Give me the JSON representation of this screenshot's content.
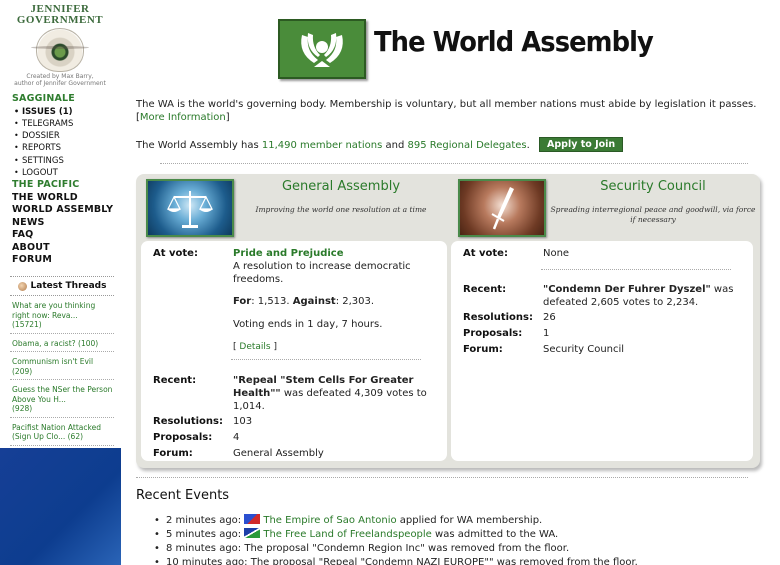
{
  "logo": {
    "line1": "JENNIFER",
    "line2": "GOVERNMENT",
    "credit1": "Created by Max Barry,",
    "credit2": "author of Jennifer Government"
  },
  "nav": {
    "region": "SAGGINALE",
    "issues": "ISSUES (1)",
    "telegrams": "TELEGRAMS",
    "dossier": "DOSSIER",
    "reports": "REPORTS",
    "settings": "SETTINGS",
    "logout": "LOGOUT",
    "pacific": "THE PACIFIC",
    "world": "THE WORLD",
    "wa": "WORLD ASSEMBLY",
    "news": "NEWS",
    "faq": "FAQ",
    "about": "ABOUT",
    "forum": "FORUM"
  },
  "threads": {
    "title": "Latest Threads",
    "items": [
      {
        "text": "What are you thinking right now: Reva...",
        "count": "(15721)"
      },
      {
        "text": "Obama, a racist?",
        "count": "(100)"
      },
      {
        "text": "Communism isn't Evil",
        "count": "(209)"
      },
      {
        "text": "Guess the NSer the Person Above You H...",
        "count": "(928)"
      },
      {
        "text": "Pacifist Nation Attacked (Sign Up Clo...",
        "count": "(62)"
      }
    ]
  },
  "header": {
    "title": "The World Assembly"
  },
  "intro": {
    "text": "The WA is the world's governing body. Membership is voluntary, but all member nations must abide by legislation it passes.",
    "more_open": "[",
    "more_link": "More Information",
    "more_close": "]"
  },
  "members": {
    "prefix": "The World Assembly has",
    "nations": "11,490 member nations",
    "and": "and",
    "delegates": "895 Regional Delegates",
    "suffix": ".",
    "apply": "Apply to Join"
  },
  "ga": {
    "name": "General Assembly",
    "tagline": "Improving the world one resolution at a time",
    "at_vote_label": "At vote:",
    "proposal_title": "Pride and Prejudice",
    "proposal_desc": "A resolution to increase democratic freedoms.",
    "for_label": "For",
    "for_value": ": 1,513.",
    "against_label": "Against",
    "against_value": ": 2,303.",
    "ends": "Voting ends in 1 day, 7 hours.",
    "details_open": "[",
    "details": "Details",
    "details_close": "]",
    "recent_label": "Recent:",
    "recent_title": "\"Repeal \"Stem Cells For Greater Health\"\"",
    "recent_rest": " was defeated 4,309 votes to 1,014.",
    "resolutions_label": "Resolutions:",
    "resolutions": "103",
    "proposals_label": "Proposals:",
    "proposals": "4",
    "forum_label": "Forum:",
    "forum": "General Assembly"
  },
  "sc": {
    "name": "Security Council",
    "tagline": "Spreading interregional peace and goodwill, via force if necessary",
    "at_vote_label": "At vote:",
    "at_vote": "None",
    "recent_label": "Recent:",
    "recent_title": "\"Condemn Der Fuhrer Dyszel\"",
    "recent_rest": " was defeated 2,605 votes to 2,234.",
    "resolutions_label": "Resolutions:",
    "resolutions": "26",
    "proposals_label": "Proposals:",
    "proposals": "1",
    "forum_label": "Forum:",
    "forum": "Security Council"
  },
  "events": {
    "title": "Recent Events",
    "items": [
      {
        "time": "2 minutes ago:",
        "link": "The Empire of Sao Antonio",
        "rest": " applied for WA membership.",
        "flag": "blue-red-flag"
      },
      {
        "time": "5 minutes ago:",
        "link": "The Free Land of Freelandspeople",
        "rest": " was admitted to the WA.",
        "flag": "blue-green-flag"
      },
      {
        "time": "8 minutes ago:",
        "link": "",
        "rest": " The proposal \"Condemn Region Inc\" was removed from the floor.",
        "flag": ""
      },
      {
        "time": "10 minutes ago:",
        "link": "",
        "rest": " The proposal \"Repeal \"Condemn NAZI EUROPE\"\" was removed from the floor.",
        "flag": ""
      }
    ]
  }
}
